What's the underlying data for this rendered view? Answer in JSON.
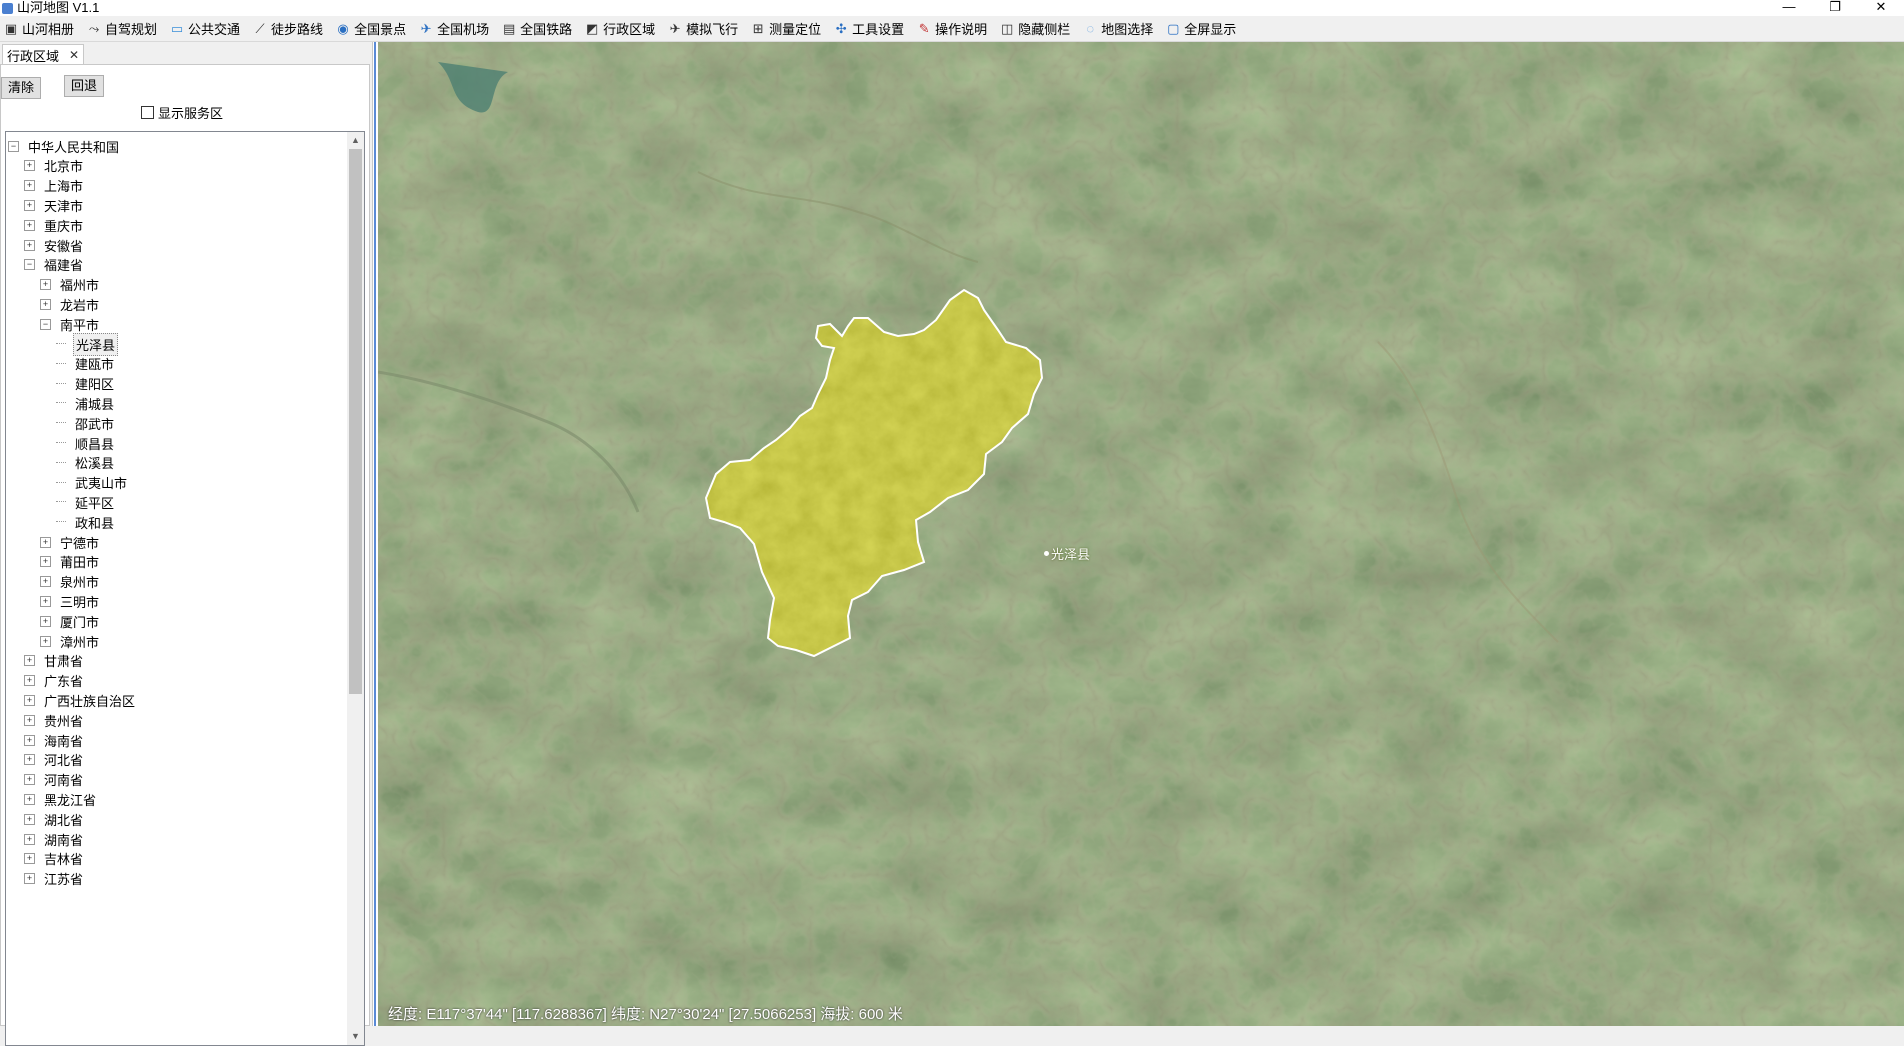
{
  "window": {
    "title": "山河地图 V1.1",
    "controls": {
      "minimize": "—",
      "restore": "❐",
      "close": "✕"
    }
  },
  "toolbar": [
    {
      "label": "山河相册",
      "icon": "album-icon"
    },
    {
      "label": "自驾规划",
      "icon": "car-route-icon"
    },
    {
      "label": "公共交通",
      "icon": "bus-icon"
    },
    {
      "label": "徒步路线",
      "icon": "walking-route-icon"
    },
    {
      "label": "全国景点",
      "icon": "scenic-spot-icon"
    },
    {
      "label": "全国机场",
      "icon": "airport-icon"
    },
    {
      "label": "全国铁路",
      "icon": "railway-icon"
    },
    {
      "label": "行政区域",
      "icon": "region-icon"
    },
    {
      "label": "模拟飞行",
      "icon": "flight-icon"
    },
    {
      "label": "测量定位",
      "icon": "measure-icon"
    },
    {
      "label": "工具设置",
      "icon": "tools-icon"
    },
    {
      "label": "操作说明",
      "icon": "help-icon"
    },
    {
      "label": "隐藏侧栏",
      "icon": "sidebar-toggle-icon"
    },
    {
      "label": "地图选择",
      "icon": "map-select-icon"
    },
    {
      "label": "全屏显示",
      "icon": "fullscreen-icon"
    }
  ],
  "panel": {
    "tab_label": "行政区域",
    "tab_close": "✕",
    "clear_button": "清除",
    "back_button": "回退",
    "show_service_area": "显示服务区",
    "show_service_area_checked": false
  },
  "tree": [
    {
      "label": "中华人民共和国",
      "level": 0,
      "expander": "−"
    },
    {
      "label": "北京市",
      "level": 1,
      "expander": "+"
    },
    {
      "label": "上海市",
      "level": 1,
      "expander": "+"
    },
    {
      "label": "天津市",
      "level": 1,
      "expander": "+"
    },
    {
      "label": "重庆市",
      "level": 1,
      "expander": "+"
    },
    {
      "label": "安徽省",
      "level": 1,
      "expander": "+"
    },
    {
      "label": "福建省",
      "level": 1,
      "expander": "−"
    },
    {
      "label": "福州市",
      "level": 2,
      "expander": "+"
    },
    {
      "label": "龙岩市",
      "level": 2,
      "expander": "+"
    },
    {
      "label": "南平市",
      "level": 2,
      "expander": "−"
    },
    {
      "label": "光泽县",
      "level": 3,
      "expander": "",
      "selected": true
    },
    {
      "label": "建瓯市",
      "level": 3,
      "expander": ""
    },
    {
      "label": "建阳区",
      "level": 3,
      "expander": ""
    },
    {
      "label": "浦城县",
      "level": 3,
      "expander": ""
    },
    {
      "label": "邵武市",
      "level": 3,
      "expander": ""
    },
    {
      "label": "顺昌县",
      "level": 3,
      "expander": ""
    },
    {
      "label": "松溪县",
      "level": 3,
      "expander": ""
    },
    {
      "label": "武夷山市",
      "level": 3,
      "expander": ""
    },
    {
      "label": "延平区",
      "level": 3,
      "expander": ""
    },
    {
      "label": "政和县",
      "level": 3,
      "expander": ""
    },
    {
      "label": "宁德市",
      "level": 2,
      "expander": "+"
    },
    {
      "label": "莆田市",
      "level": 2,
      "expander": "+"
    },
    {
      "label": "泉州市",
      "level": 2,
      "expander": "+"
    },
    {
      "label": "三明市",
      "level": 2,
      "expander": "+"
    },
    {
      "label": "厦门市",
      "level": 2,
      "expander": "+"
    },
    {
      "label": "漳州市",
      "level": 2,
      "expander": "+"
    },
    {
      "label": "甘肃省",
      "level": 1,
      "expander": "+"
    },
    {
      "label": "广东省",
      "level": 1,
      "expander": "+"
    },
    {
      "label": "广西壮族自治区",
      "level": 1,
      "expander": "+"
    },
    {
      "label": "贵州省",
      "level": 1,
      "expander": "+"
    },
    {
      "label": "海南省",
      "level": 1,
      "expander": "+"
    },
    {
      "label": "河北省",
      "level": 1,
      "expander": "+"
    },
    {
      "label": "河南省",
      "level": 1,
      "expander": "+"
    },
    {
      "label": "黑龙江省",
      "level": 1,
      "expander": "+"
    },
    {
      "label": "湖北省",
      "level": 1,
      "expander": "+"
    },
    {
      "label": "湖南省",
      "level": 1,
      "expander": "+"
    },
    {
      "label": "吉林省",
      "level": 1,
      "expander": "+"
    },
    {
      "label": "江苏省",
      "level": 1,
      "expander": "+"
    }
  ],
  "scrollbar": {
    "up": "▲",
    "down": "▼"
  },
  "map": {
    "highlight_label": "光泽县",
    "highlight_fill": "#b4b42a",
    "status": "经度: E117°37'44\" [117.6288367] 纬度: N27°30'24\" [27.5066253] 海拔: 600 米"
  }
}
